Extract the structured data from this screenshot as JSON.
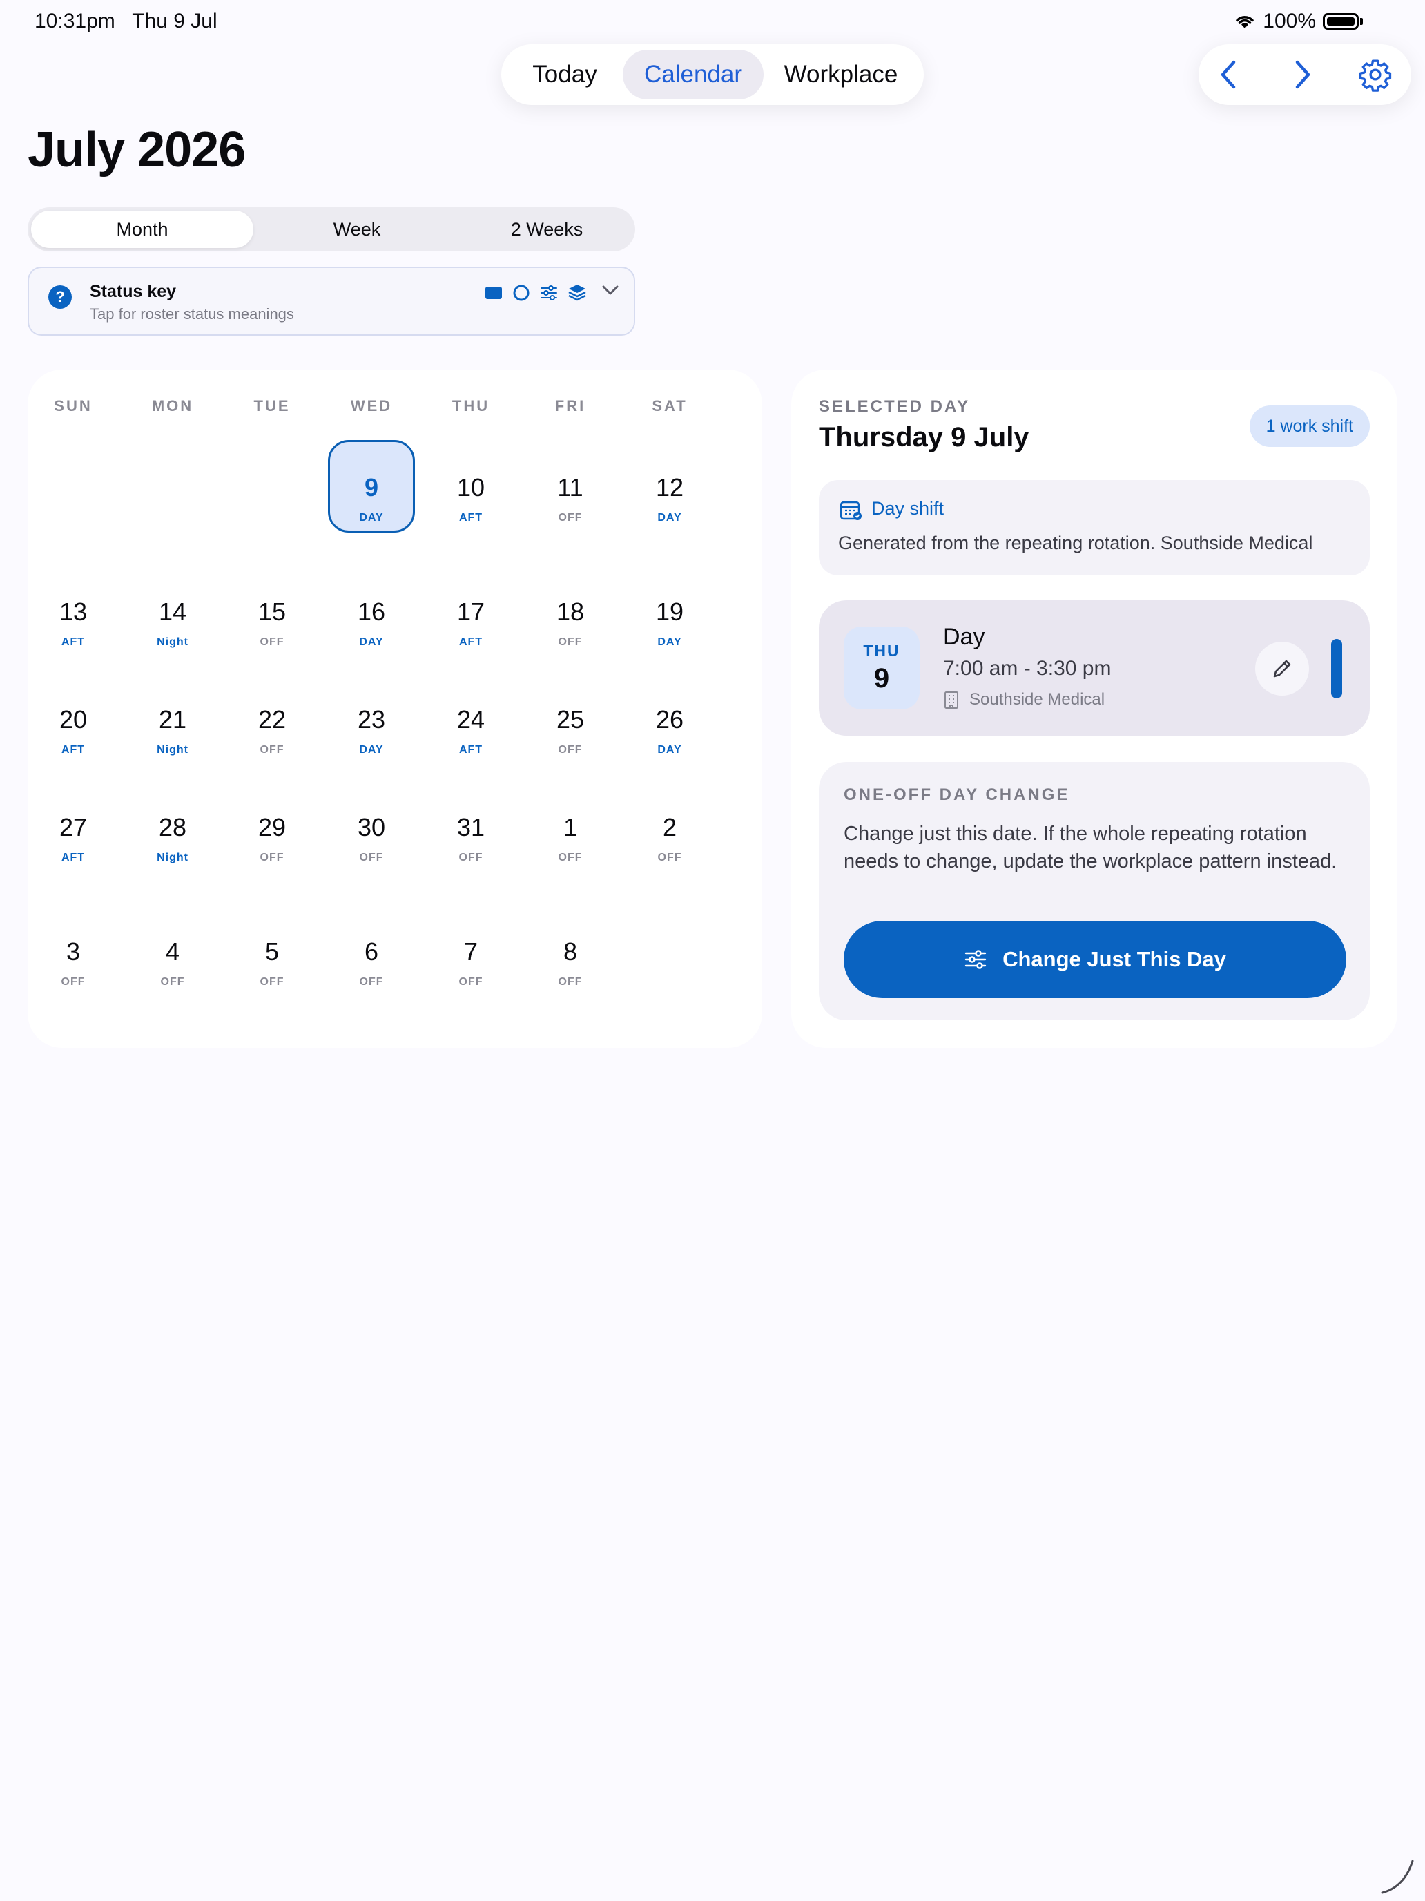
{
  "status_bar": {
    "time": "10:31pm",
    "date": "Thu 9 Jul",
    "battery": "100%"
  },
  "top_tabs": [
    {
      "label": "Today"
    },
    {
      "label": "Calendar",
      "selected": true
    },
    {
      "label": "Workplace"
    }
  ],
  "nav": {
    "prev_icon": "chevron-left-icon",
    "next_icon": "chevron-right-icon",
    "settings_icon": "gear-icon"
  },
  "page_title": "July 2026",
  "view_mode": {
    "options": [
      "Month",
      "Week",
      "2 Weeks"
    ],
    "selected": "Month"
  },
  "status_key": {
    "title": "Status key",
    "subtitle": "Tap for roster status meanings",
    "icons": [
      "filled-square-icon",
      "circle-outline-icon",
      "sliders-icon",
      "layers-icon"
    ]
  },
  "calendar": {
    "weekdays": [
      "SUN",
      "MON",
      "TUE",
      "WED",
      "THU",
      "FRI",
      "SAT"
    ],
    "rows": [
      [
        null,
        null,
        null,
        {
          "d": "9",
          "s": "DAY",
          "sel": true
        },
        {
          "d": "10",
          "s": "AFT"
        },
        {
          "d": "11",
          "s": "OFF"
        },
        {
          "d": "12",
          "s": "DAY"
        }
      ],
      [
        {
          "d": "13",
          "s": "AFT"
        },
        {
          "d": "14",
          "s": "Night"
        },
        {
          "d": "15",
          "s": "OFF"
        },
        {
          "d": "16",
          "s": "DAY"
        },
        {
          "d": "17",
          "s": "AFT"
        },
        {
          "d": "18",
          "s": "OFF"
        },
        {
          "d": "19",
          "s": "DAY"
        }
      ],
      [
        {
          "d": "20",
          "s": "AFT"
        },
        {
          "d": "21",
          "s": "Night"
        },
        {
          "d": "22",
          "s": "OFF"
        },
        {
          "d": "23",
          "s": "DAY"
        },
        {
          "d": "24",
          "s": "AFT"
        },
        {
          "d": "25",
          "s": "OFF"
        },
        {
          "d": "26",
          "s": "DAY"
        }
      ],
      [
        {
          "d": "27",
          "s": "AFT"
        },
        {
          "d": "28",
          "s": "Night"
        },
        {
          "d": "29",
          "s": "OFF"
        },
        {
          "d": "30",
          "s": "OFF"
        },
        {
          "d": "31",
          "s": "OFF"
        },
        {
          "d": "1",
          "s": "OFF"
        },
        {
          "d": "2",
          "s": "OFF"
        }
      ],
      [
        {
          "d": "3",
          "s": "OFF"
        },
        {
          "d": "4",
          "s": "OFF"
        },
        {
          "d": "5",
          "s": "OFF"
        },
        {
          "d": "6",
          "s": "OFF"
        },
        {
          "d": "7",
          "s": "OFF"
        },
        {
          "d": "8",
          "s": "OFF"
        },
        null
      ]
    ]
  },
  "selected_day": {
    "caption": "SELECTED DAY",
    "date": "Thursday 9 July",
    "badge": "1 work shift",
    "info": {
      "title": "Day shift",
      "description": "Generated from the repeating rotation. Southside Medical"
    },
    "shift": {
      "dow": "THU",
      "day": "9",
      "title": "Day",
      "time": "7:00 am - 3:30 pm",
      "location": "Southside Medical"
    },
    "change": {
      "caption": "ONE-OFF DAY CHANGE",
      "description": "Change just this date. If the whole repeating rotation needs to change, update the workplace pattern instead.",
      "button_label": "Change Just This Day"
    }
  },
  "colors": {
    "accent": "#0a63c1",
    "tab_accent": "#1f5fd6",
    "background": "#fbfaff",
    "muted": "#8a8a94"
  }
}
